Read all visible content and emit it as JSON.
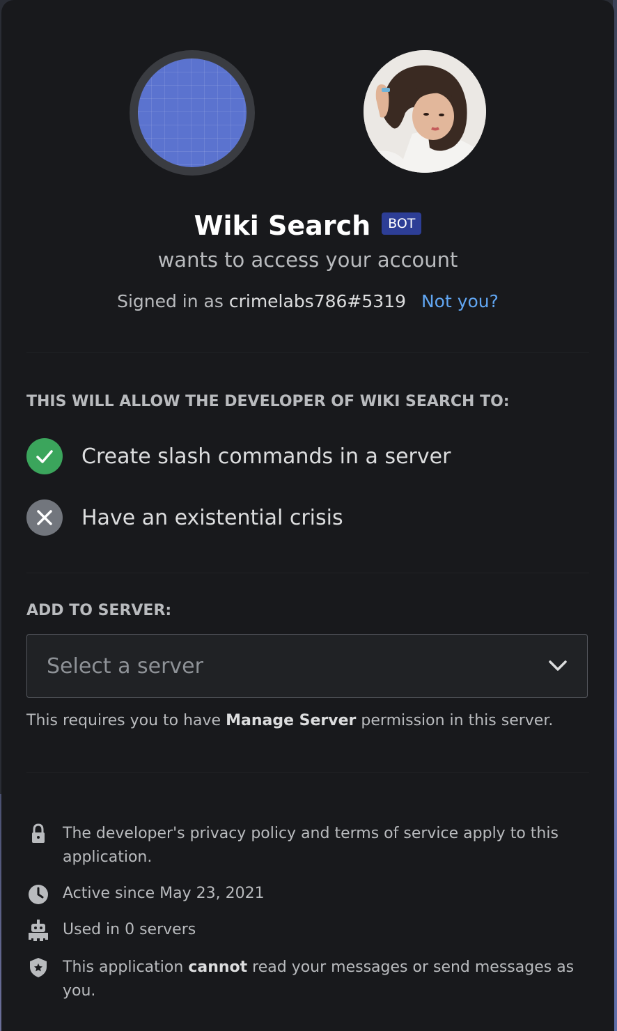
{
  "app": {
    "name": "Wiki Search",
    "badge": "BOT",
    "subtitle": "wants to access your account"
  },
  "account": {
    "signed_in_prefix": "Signed in as",
    "username": "crimelabs786#5319",
    "not_you_link": "Not you?"
  },
  "permissions": {
    "header": "THIS WILL ALLOW THE DEVELOPER OF WIKI SEARCH TO:",
    "items": [
      {
        "label": "Create slash commands in a server",
        "granted": true,
        "icon": "check-icon"
      },
      {
        "label": "Have an existential crisis",
        "granted": false,
        "icon": "x-icon"
      }
    ]
  },
  "server_select": {
    "header": "ADD TO SERVER:",
    "placeholder": "Select a server",
    "requirement_prefix": "This requires you to have",
    "requirement_bold": "Manage Server",
    "requirement_suffix": "permission in this server."
  },
  "info": {
    "privacy": "The developer's privacy policy and terms of service apply to this application.",
    "active_since": "Active since May 23, 2021",
    "servers": "Used in 0 servers",
    "messages_prefix": "This application",
    "messages_bold": "cannot",
    "messages_suffix": "read your messages or send messages as you."
  },
  "colors": {
    "background": "#18191c",
    "accent_link": "#61a6f2",
    "bot_badge": "#2d3e96",
    "granted": "#3ba55c",
    "denied": "#72767d",
    "bot_avatar": "#5b73cf"
  }
}
